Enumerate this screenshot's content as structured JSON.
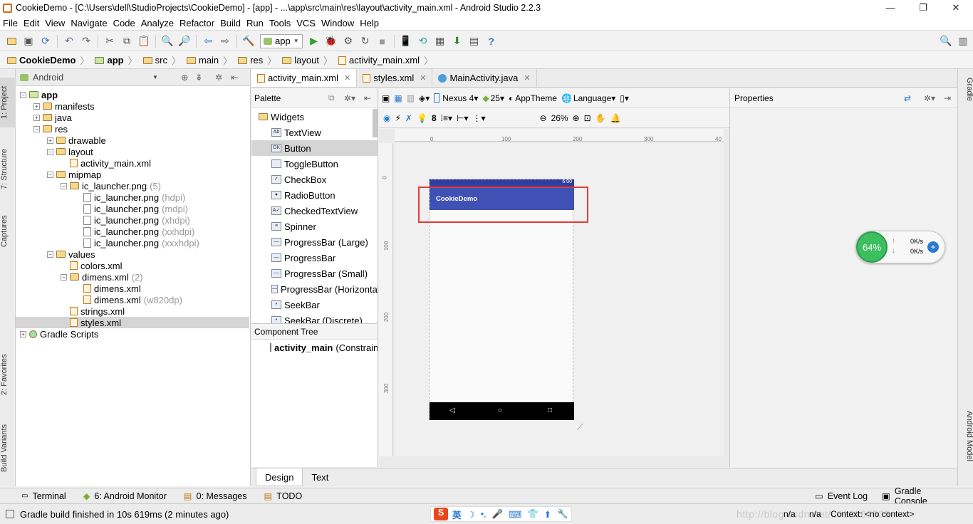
{
  "window": {
    "title": "CookieDemo - [C:\\Users\\dell\\StudioProjects\\CookieDemo] - [app] - ...\\app\\src\\main\\res\\layout\\activity_main.xml - Android Studio 2.2.3",
    "minimize": "—",
    "restore": "❐",
    "close": "✕"
  },
  "menu": [
    "File",
    "Edit",
    "View",
    "Navigate",
    "Code",
    "Analyze",
    "Refactor",
    "Build",
    "Run",
    "Tools",
    "VCS",
    "Window",
    "Help"
  ],
  "toolbar": {
    "run_config": "app"
  },
  "breadcrumb": [
    "CookieDemo",
    "app",
    "src",
    "main",
    "res",
    "layout",
    "activity_main.xml"
  ],
  "left_strip": [
    "1: Project",
    "7: Structure",
    "Captures",
    "2: Favorites",
    "Build Variants"
  ],
  "right_strip": [
    "Gradle",
    "Android Model"
  ],
  "project": {
    "view": "Android",
    "tree": [
      {
        "label": "app",
        "depth": 0,
        "kind": "module",
        "bold": true
      },
      {
        "label": "manifests",
        "depth": 1,
        "kind": "folder"
      },
      {
        "label": "java",
        "depth": 1,
        "kind": "folder"
      },
      {
        "label": "res",
        "depth": 1,
        "kind": "folder"
      },
      {
        "label": "drawable",
        "depth": 2,
        "kind": "folder"
      },
      {
        "label": "layout",
        "depth": 2,
        "kind": "folder"
      },
      {
        "label": "activity_main.xml",
        "depth": 3,
        "kind": "xml"
      },
      {
        "label": "mipmap",
        "depth": 2,
        "kind": "folder"
      },
      {
        "label": "ic_launcher.png",
        "hint": "(5)",
        "depth": 3,
        "kind": "folder"
      },
      {
        "label": "ic_launcher.png",
        "hint": "(hdpi)",
        "depth": 4,
        "kind": "png"
      },
      {
        "label": "ic_launcher.png",
        "hint": "(mdpi)",
        "depth": 4,
        "kind": "png"
      },
      {
        "label": "ic_launcher.png",
        "hint": "(xhdpi)",
        "depth": 4,
        "kind": "png"
      },
      {
        "label": "ic_launcher.png",
        "hint": "(xxhdpi)",
        "depth": 4,
        "kind": "png"
      },
      {
        "label": "ic_launcher.png",
        "hint": "(xxxhdpi)",
        "depth": 4,
        "kind": "png"
      },
      {
        "label": "values",
        "depth": 2,
        "kind": "folder"
      },
      {
        "label": "colors.xml",
        "depth": 3,
        "kind": "xml"
      },
      {
        "label": "dimens.xml",
        "hint": "(2)",
        "depth": 3,
        "kind": "folder"
      },
      {
        "label": "dimens.xml",
        "depth": 4,
        "kind": "xml"
      },
      {
        "label": "dimens.xml",
        "hint": "(w820dp)",
        "depth": 4,
        "kind": "xml"
      },
      {
        "label": "strings.xml",
        "depth": 3,
        "kind": "xml"
      },
      {
        "label": "styles.xml",
        "depth": 3,
        "kind": "xml",
        "selected": true
      },
      {
        "label": "Gradle Scripts",
        "depth": 0,
        "kind": "gradle"
      }
    ]
  },
  "editor_tabs": [
    {
      "label": "activity_main.xml",
      "active": true
    },
    {
      "label": "styles.xml",
      "active": false
    },
    {
      "label": "MainActivity.java",
      "active": false
    }
  ],
  "palette": {
    "title": "Palette",
    "group": "Widgets",
    "items": [
      {
        "label": "TextView",
        "icon": "Ab"
      },
      {
        "label": "Button",
        "icon": "OK",
        "selected": true
      },
      {
        "label": "ToggleButton",
        "icon": ""
      },
      {
        "label": "CheckBox",
        "icon": "✓"
      },
      {
        "label": "RadioButton",
        "icon": "●"
      },
      {
        "label": "CheckedTextView",
        "icon": "A✓"
      },
      {
        "label": "Spinner",
        "icon": "≡"
      },
      {
        "label": "ProgressBar (Large)",
        "icon": "—"
      },
      {
        "label": "ProgressBar",
        "icon": "—"
      },
      {
        "label": "ProgressBar (Small)",
        "icon": "—"
      },
      {
        "label": "ProgressBar (Horizontal)",
        "icon": "—"
      },
      {
        "label": "SeekBar",
        "icon": "•"
      },
      {
        "label": "SeekBar (Discrete)",
        "icon": "•"
      }
    ]
  },
  "component_tree": {
    "title": "Component Tree",
    "root": "activity_main",
    "root_type": "(ConstraintLayout)"
  },
  "design_toolbar": {
    "device": "Nexus 4",
    "api": "25",
    "theme": "AppTheme",
    "language": "Language",
    "margin": "8",
    "zoom": "26%"
  },
  "ruler": {
    "h": [
      "0",
      "100",
      "200",
      "300",
      "40"
    ],
    "v": [
      "0",
      "100",
      "200",
      "300"
    ]
  },
  "device_preview": {
    "status_time": "6:00",
    "app_title": "CookieDemo",
    "accent": "#3f51b5",
    "highlight": "#e53935"
  },
  "properties": {
    "title": "Properties"
  },
  "net_widget": {
    "percent": "64%",
    "up": "0K/s",
    "down": "0K/s"
  },
  "design_tabs": [
    "Design",
    "Text"
  ],
  "tool_windows": {
    "left": [
      "Terminal",
      "6: Android Monitor",
      "0: Messages",
      "TODO"
    ],
    "right": [
      "Event Log",
      "Gradle Console"
    ]
  },
  "status": {
    "message": "Gradle build finished in 10s 619ms (2 minutes ago)",
    "ime": "英",
    "watermark": "http://blog.csdn.net/u013267535",
    "na1": "n/a",
    "na2": "n/a",
    "context": "Context: <no context>"
  }
}
